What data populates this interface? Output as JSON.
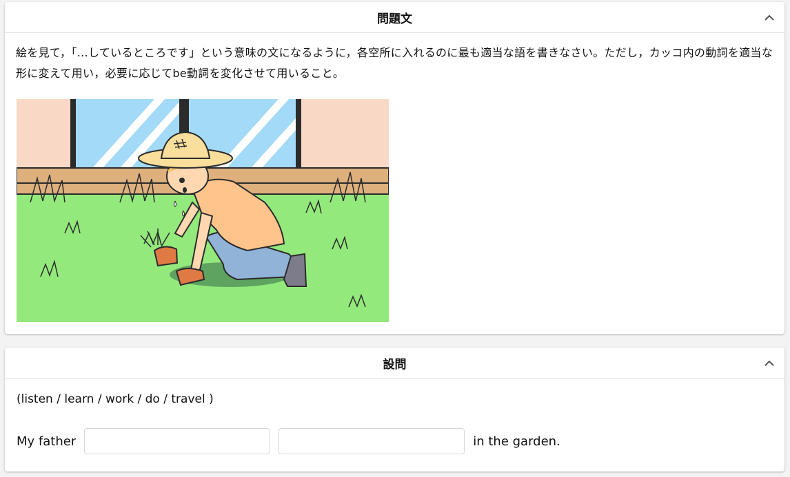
{
  "problem_card": {
    "title": "問題文",
    "text": "絵を見て，「…しているところです」という意味の文になるように，各空所に入れるのに最も適当な語を書きなさい。ただし，カッコ内の動詞を適当な形に変えて用い，必要に応じてbe動詞を変化させて用いること。",
    "collapse_icon": "chevron-up-icon"
  },
  "question_card": {
    "title": "設問",
    "choices": "(listen / learn / work / do / travel )",
    "sentence_prefix": "My father",
    "sentence_suffix": "in the garden.",
    "blank1_value": "",
    "blank2_value": "",
    "collapse_icon": "chevron-up-icon"
  },
  "colors": {
    "wall": "#f9d9c6",
    "window_glass": "#a3daf7",
    "grass": "#93e97b",
    "fence": "#ddb07d",
    "shirt": "#ffc48c",
    "jeans": "#92b3d8"
  }
}
